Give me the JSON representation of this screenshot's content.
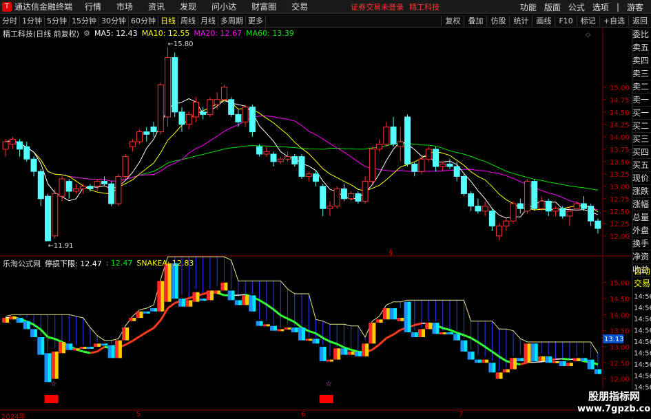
{
  "menubar": {
    "app_title": "通达信金融终端",
    "items": [
      "行情",
      "市场",
      "资讯",
      "发现",
      "问小达",
      "财富圈",
      "交易"
    ],
    "notice": "证券交易未登录",
    "stock": "精工科技",
    "right_items": [
      "功能",
      "版面",
      "公式",
      "选项",
      "|",
      "游客"
    ]
  },
  "toolbar": {
    "periods": [
      "分时",
      "1分钟",
      "5分钟",
      "15分钟",
      "30分钟",
      "60分钟",
      "日线",
      "周线",
      "月线",
      "多周期",
      "更多"
    ],
    "active_period": "日线",
    "right_items": [
      "复权",
      "叠加",
      "仿股",
      "统计",
      "画线",
      "F10",
      "标记",
      "+自选",
      "返回"
    ]
  },
  "upper": {
    "title": "精工科技(日线 前复权)",
    "ma5": "MA5: 12.43",
    "ma10": "MA10: 12.55",
    "ma20": "MA20: 12.67",
    "ma60": "MA60: 13.39",
    "high_label": "15.80",
    "low_label": "11.91",
    "y_ticks": [
      "15.00",
      "14.75",
      "14.50",
      "14.25",
      "14.00",
      "13.75",
      "13.50",
      "13.25",
      "13.00",
      "12.75",
      "12.50",
      "12.25",
      "12.00"
    ],
    "marker": "§"
  },
  "lower": {
    "title": "乐淘公式网",
    "stop_loss": "停损下限: 12.47",
    "value2": ": 12.47",
    "snakea": "SNAKEA: 12.83",
    "y_ticks": [
      "15.00",
      "14.50",
      "14.00",
      "13.50",
      "13.00",
      "12.50",
      "12.00"
    ],
    "current_badge": "13.13"
  },
  "side_panel": [
    "委比",
    "卖五",
    "卖四",
    "卖三",
    "卖二",
    "卖一",
    "买一",
    "买二",
    "买三",
    "买四",
    "买五",
    "现价",
    "涨跌",
    "涨幅",
    "总量",
    "外盘",
    "换手",
    "净资",
    "收益"
  ],
  "side_panel2": [
    "自动",
    "交易"
  ],
  "side_panel3": [
    "14:56",
    "14:56",
    "14:56",
    "14:56",
    "14:56",
    "14:56",
    "14:56",
    "14:56",
    "14:56"
  ],
  "x_axis": [
    "2024年",
    "5",
    "6",
    "7"
  ],
  "watermark": {
    "line1": "股朋指标网",
    "line2": "www.7gpzb.com"
  },
  "colors": {
    "up": "#ff3232",
    "down": "#54ffff",
    "ma5": "#ffffff",
    "ma10": "#ffff00",
    "ma20": "#ff00ff",
    "ma60": "#00e600"
  },
  "chart_data": {
    "type": "candlestick",
    "ylim_upper": [
      11.9,
      15.9
    ],
    "candles": [
      {
        "o": 13.75,
        "c": 13.9,
        "h": 13.95,
        "l": 13.6
      },
      {
        "o": 13.85,
        "c": 13.95,
        "h": 14.0,
        "l": 13.75
      },
      {
        "o": 13.9,
        "c": 13.75,
        "h": 13.95,
        "l": 13.6
      },
      {
        "o": 13.8,
        "c": 13.55,
        "h": 13.9,
        "l": 13.5
      },
      {
        "o": 13.55,
        "c": 13.3,
        "h": 13.6,
        "l": 13.2
      },
      {
        "o": 13.3,
        "c": 12.75,
        "h": 13.35,
        "l": 12.6
      },
      {
        "o": 12.8,
        "c": 11.9,
        "h": 12.85,
        "l": 11.9
      },
      {
        "o": 12.0,
        "c": 12.85,
        "h": 12.95,
        "l": 11.95
      },
      {
        "o": 12.8,
        "c": 13.15,
        "h": 13.2,
        "l": 12.7
      },
      {
        "o": 13.1,
        "c": 12.9,
        "h": 13.15,
        "l": 12.75
      },
      {
        "o": 12.9,
        "c": 12.95,
        "h": 13.05,
        "l": 12.85
      },
      {
        "o": 12.95,
        "c": 13.0,
        "h": 13.05,
        "l": 12.85
      },
      {
        "o": 13.0,
        "c": 12.95,
        "h": 13.05,
        "l": 12.9
      },
      {
        "o": 13.0,
        "c": 13.1,
        "h": 13.15,
        "l": 12.9
      },
      {
        "o": 13.1,
        "c": 13.05,
        "h": 13.2,
        "l": 13.0
      },
      {
        "o": 13.05,
        "c": 12.65,
        "h": 13.1,
        "l": 12.6
      },
      {
        "o": 12.65,
        "c": 13.2,
        "h": 13.25,
        "l": 12.6
      },
      {
        "o": 13.2,
        "c": 13.6,
        "h": 13.65,
        "l": 13.15
      },
      {
        "o": 13.8,
        "c": 13.9,
        "h": 13.95,
        "l": 13.7
      },
      {
        "o": 13.9,
        "c": 14.1,
        "h": 14.15,
        "l": 13.85
      },
      {
        "o": 14.1,
        "c": 14.05,
        "h": 14.2,
        "l": 13.9
      },
      {
        "o": 14.2,
        "c": 14.1,
        "h": 14.3,
        "l": 14.0
      },
      {
        "o": 14.1,
        "c": 15.05,
        "h": 15.1,
        "l": 14.05
      },
      {
        "o": 14.4,
        "c": 15.6,
        "h": 15.8,
        "l": 14.2
      },
      {
        "o": 15.6,
        "c": 14.5,
        "h": 15.7,
        "l": 14.4
      },
      {
        "o": 14.5,
        "c": 14.25,
        "h": 14.6,
        "l": 14.1
      },
      {
        "o": 14.25,
        "c": 14.45,
        "h": 14.5,
        "l": 14.15
      },
      {
        "o": 14.4,
        "c": 14.7,
        "h": 14.8,
        "l": 14.3
      },
      {
        "o": 14.5,
        "c": 14.45,
        "h": 14.6,
        "l": 14.35
      },
      {
        "o": 14.45,
        "c": 14.75,
        "h": 14.8,
        "l": 14.4
      },
      {
        "o": 14.65,
        "c": 14.75,
        "h": 14.9,
        "l": 14.55
      },
      {
        "o": 14.75,
        "c": 15.0,
        "h": 15.05,
        "l": 14.7
      },
      {
        "o": 14.75,
        "c": 14.45,
        "h": 14.8,
        "l": 14.4
      },
      {
        "o": 14.45,
        "c": 14.3,
        "h": 14.55,
        "l": 14.2
      },
      {
        "o": 14.3,
        "c": 14.6,
        "h": 14.65,
        "l": 14.2
      },
      {
        "o": 14.6,
        "c": 14.1,
        "h": 14.65,
        "l": 14.0
      },
      {
        "o": 13.8,
        "c": 13.65,
        "h": 13.85,
        "l": 13.6
      },
      {
        "o": 13.65,
        "c": 13.7,
        "h": 13.8,
        "l": 13.6
      },
      {
        "o": 13.65,
        "c": 13.5,
        "h": 13.7,
        "l": 13.4
      },
      {
        "o": 13.5,
        "c": 13.55,
        "h": 13.6,
        "l": 13.45
      },
      {
        "o": 13.55,
        "c": 13.6,
        "h": 13.7,
        "l": 13.5
      },
      {
        "o": 13.6,
        "c": 13.45,
        "h": 13.65,
        "l": 13.4
      },
      {
        "o": 13.6,
        "c": 13.2,
        "h": 13.65,
        "l": 13.15
      },
      {
        "o": 13.2,
        "c": 13.25,
        "h": 13.3,
        "l": 13.1
      },
      {
        "o": 13.25,
        "c": 13.1,
        "h": 13.3,
        "l": 13.0
      },
      {
        "o": 13.0,
        "c": 12.55,
        "h": 13.05,
        "l": 12.4
      },
      {
        "o": 12.55,
        "c": 12.6,
        "h": 12.7,
        "l": 12.4
      },
      {
        "o": 12.6,
        "c": 12.95,
        "h": 13.0,
        "l": 12.55
      },
      {
        "o": 12.95,
        "c": 12.75,
        "h": 13.05,
        "l": 12.7
      },
      {
        "o": 12.75,
        "c": 12.85,
        "h": 12.9,
        "l": 12.7
      },
      {
        "o": 12.85,
        "c": 12.7,
        "h": 12.9,
        "l": 12.65
      },
      {
        "o": 12.7,
        "c": 13.1,
        "h": 13.2,
        "l": 12.65
      },
      {
        "o": 13.1,
        "c": 13.75,
        "h": 13.8,
        "l": 13.05
      },
      {
        "o": 13.75,
        "c": 13.85,
        "h": 13.95,
        "l": 13.7
      },
      {
        "o": 13.85,
        "c": 14.2,
        "h": 14.3,
        "l": 13.8
      },
      {
        "o": 14.2,
        "c": 13.85,
        "h": 14.4,
        "l": 13.8
      },
      {
        "o": 13.8,
        "c": 13.9,
        "h": 14.2,
        "l": 13.5
      },
      {
        "o": 14.4,
        "c": 13.45,
        "h": 14.45,
        "l": 13.4
      },
      {
        "o": 13.45,
        "c": 13.3,
        "h": 13.5,
        "l": 13.2
      },
      {
        "o": 13.3,
        "c": 13.55,
        "h": 13.6,
        "l": 13.25
      },
      {
        "o": 13.55,
        "c": 13.75,
        "h": 13.8,
        "l": 13.5
      },
      {
        "o": 13.75,
        "c": 13.4,
        "h": 13.8,
        "l": 13.3
      },
      {
        "o": 13.4,
        "c": 13.45,
        "h": 13.5,
        "l": 13.3
      },
      {
        "o": 13.45,
        "c": 13.4,
        "h": 13.55,
        "l": 13.35
      },
      {
        "o": 13.4,
        "c": 13.2,
        "h": 13.5,
        "l": 13.1
      },
      {
        "o": 13.2,
        "c": 12.85,
        "h": 13.25,
        "l": 12.8
      },
      {
        "o": 12.85,
        "c": 12.6,
        "h": 12.9,
        "l": 12.5
      },
      {
        "o": 12.6,
        "c": 12.5,
        "h": 12.75,
        "l": 12.45
      },
      {
        "o": 12.5,
        "c": 12.6,
        "h": 12.7,
        "l": 12.4
      },
      {
        "o": 12.5,
        "c": 12.2,
        "h": 12.55,
        "l": 12.1
      },
      {
        "o": 12.0,
        "c": 12.2,
        "h": 12.25,
        "l": 11.91
      },
      {
        "o": 12.2,
        "c": 12.3,
        "h": 12.35,
        "l": 12.1
      },
      {
        "o": 12.3,
        "c": 12.65,
        "h": 12.7,
        "l": 12.25
      },
      {
        "o": 12.65,
        "c": 12.55,
        "h": 12.75,
        "l": 12.45
      },
      {
        "o": 12.5,
        "c": 13.1,
        "h": 13.15,
        "l": 12.45
      },
      {
        "o": 13.1,
        "c": 12.55,
        "h": 13.15,
        "l": 12.5
      },
      {
        "o": 12.55,
        "c": 12.7,
        "h": 12.8,
        "l": 12.5
      },
      {
        "o": 12.7,
        "c": 12.5,
        "h": 12.75,
        "l": 12.4
      },
      {
        "o": 12.5,
        "c": 12.55,
        "h": 12.6,
        "l": 12.4
      },
      {
        "o": 12.55,
        "c": 12.4,
        "h": 12.6,
        "l": 12.35
      },
      {
        "o": 12.4,
        "c": 12.5,
        "h": 12.6,
        "l": 12.2
      },
      {
        "o": 12.55,
        "c": 12.65,
        "h": 12.7,
        "l": 12.5
      },
      {
        "o": 12.65,
        "c": 12.55,
        "h": 12.8,
        "l": 12.5
      },
      {
        "o": 12.6,
        "c": 12.3,
        "h": 12.65,
        "l": 12.2
      },
      {
        "o": 12.3,
        "c": 12.15,
        "h": 12.35,
        "l": 12.05
      }
    ]
  }
}
